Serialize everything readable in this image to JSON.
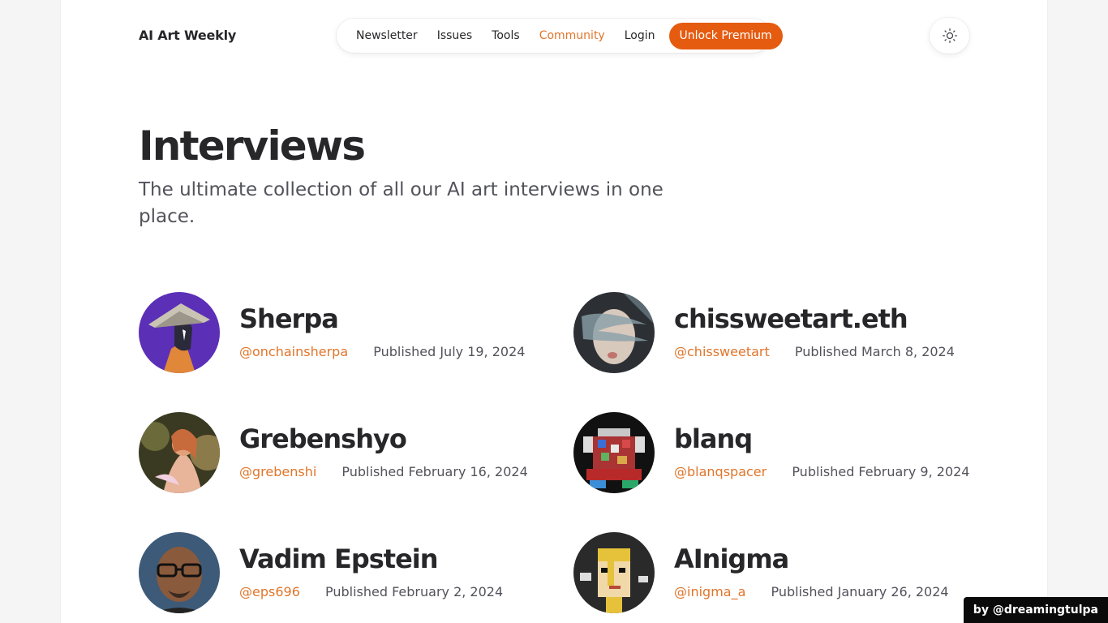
{
  "header": {
    "logo": "AI Art Weekly",
    "nav": [
      {
        "label": "Newsletter",
        "active": false
      },
      {
        "label": "Issues",
        "active": false
      },
      {
        "label": "Tools",
        "active": false
      },
      {
        "label": "Community",
        "active": true
      },
      {
        "label": "Login",
        "active": false
      }
    ],
    "premium_label": "Unlock Premium",
    "theme_icon": "sun-icon"
  },
  "hero": {
    "title": "Interviews",
    "subtitle": "The ultimate collection of all our AI art interviews in one place."
  },
  "interviews": [
    {
      "name": "Sherpa",
      "handle": "@onchainsherpa",
      "published": "Published July 19, 2024"
    },
    {
      "name": "chissweetart.eth",
      "handle": "@chissweetart",
      "published": "Published March 8, 2024"
    },
    {
      "name": "Grebenshyo",
      "handle": "@grebenshi",
      "published": "Published February 16, 2024"
    },
    {
      "name": "blanq",
      "handle": "@blanqspacer",
      "published": "Published February 9, 2024"
    },
    {
      "name": "Vadim Epstein",
      "handle": "@eps696",
      "published": "Published February 2, 2024"
    },
    {
      "name": "AInigma",
      "handle": "@inigma_a",
      "published": "Published January 26, 2024"
    }
  ],
  "badge": "by @dreamingtulpa",
  "colors": {
    "accent": "#e0752b",
    "premium": "#e55b10",
    "text": "#27272a",
    "muted": "#52525b"
  }
}
